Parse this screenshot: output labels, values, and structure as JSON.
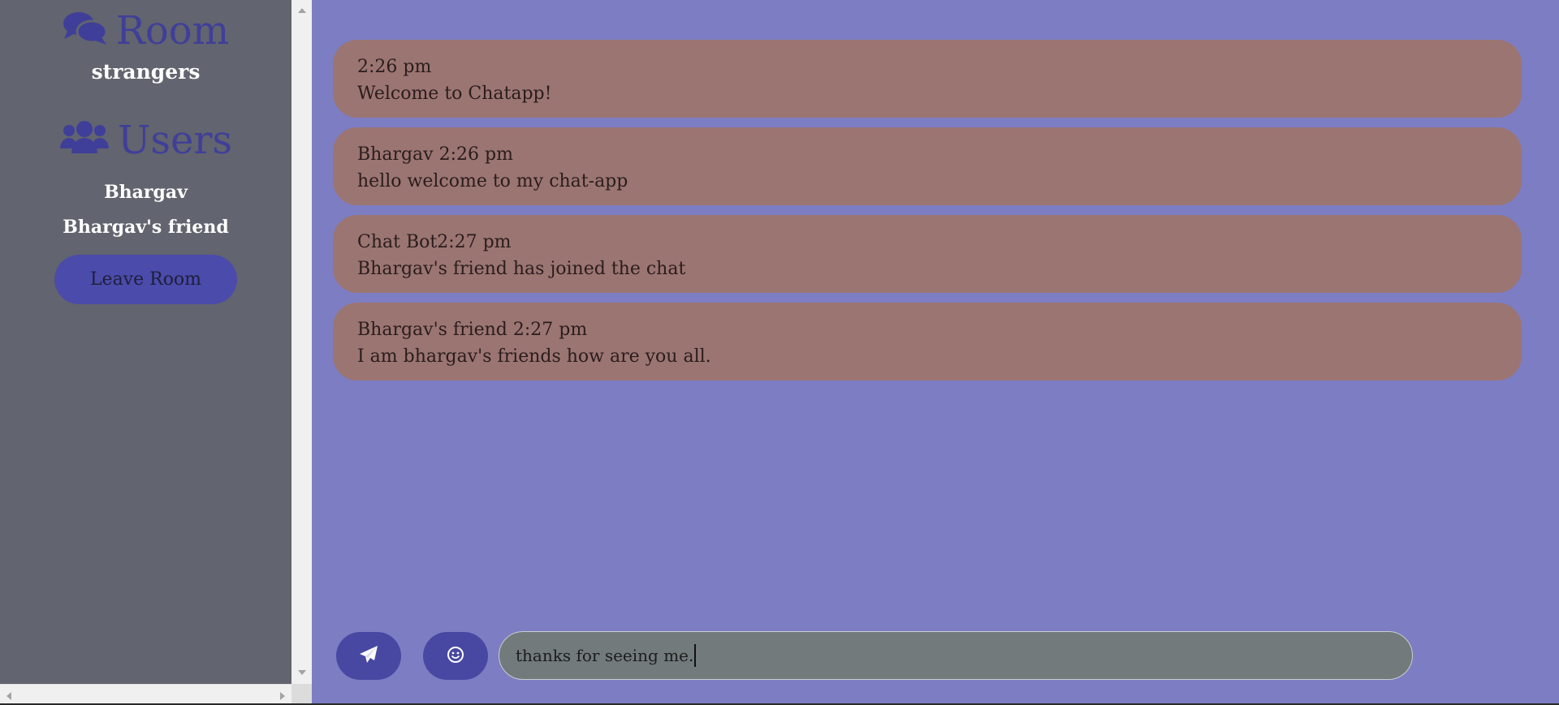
{
  "sidebar": {
    "room_heading": "Room",
    "room_icon": "comments-icon",
    "room_name": "strangers",
    "users_heading": "Users",
    "users_icon": "users-icon",
    "users": [
      "Bhargav",
      "Bhargav's friend"
    ],
    "leave_button_label": "Leave Room"
  },
  "messages": [
    {
      "meta": "2:26 pm",
      "text": "Welcome to Chatapp!"
    },
    {
      "meta": "Bhargav 2:26 pm",
      "text": "hello welcome to my chat-app"
    },
    {
      "meta": "Chat Bot2:27 pm",
      "text": "Bhargav's friend has joined the chat"
    },
    {
      "meta": "Bhargav's friend 2:27 pm",
      "text": "I am bhargav's friends how are you all."
    }
  ],
  "input_bar": {
    "send_icon": "paper-plane-icon",
    "emoji_icon": "smile-icon",
    "message_value": "thanks for seeing me."
  },
  "colors": {
    "sidebar_bg": "#62646f",
    "chat_bg": "#7d7dc3",
    "message_bg": "#9b7572",
    "accent": "#4848a3",
    "heading": "#3f3f99",
    "input_bg": "#727a7b"
  }
}
